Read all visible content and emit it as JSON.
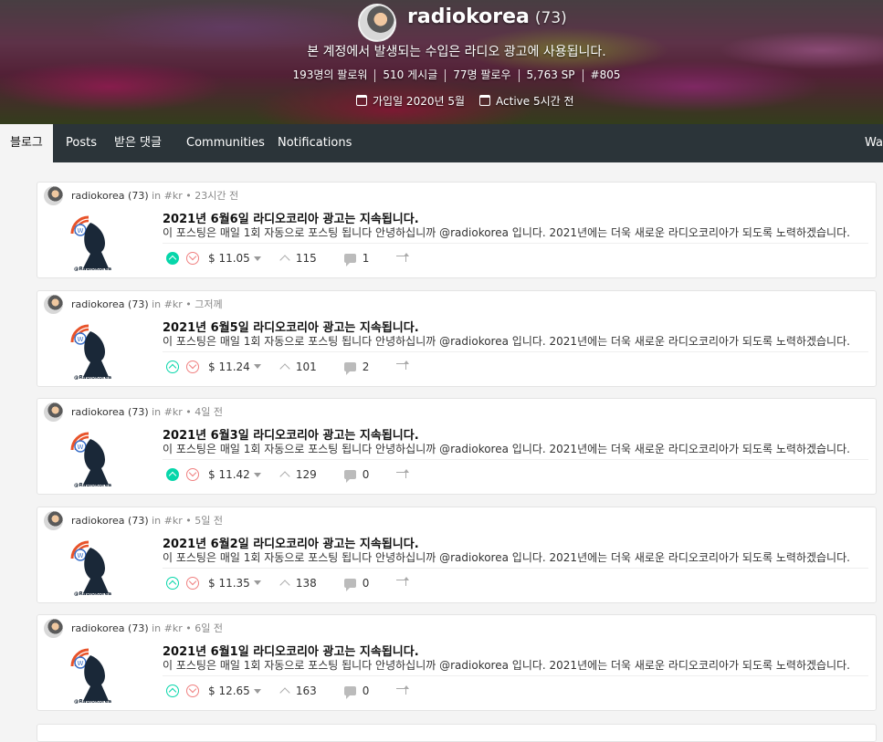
{
  "profile": {
    "username": "radiokorea",
    "reputation": "(73)",
    "subtitle": "본 계정에서 발생되는 수입은 라디오 광고에 사용됩니다.",
    "stats": {
      "followers": "193명의 팔로워",
      "posts": "510 게시글",
      "following": "77명 팔로우",
      "sp": "5,763 SP",
      "rank": "#805"
    },
    "joined": "가입일 2020년 5월",
    "active": "Active 5시간 전"
  },
  "nav": {
    "tabs": [
      {
        "label": "블로그",
        "active": true
      },
      {
        "label": "Posts"
      },
      {
        "label": "받은 댓글"
      },
      {
        "label": "Communities"
      },
      {
        "label": "Notifications"
      }
    ],
    "right_label": "Wa"
  },
  "posts": [
    {
      "author": "radiokorea (73)",
      "in": "in",
      "tag": "#kr",
      "time": "23시간 전",
      "title": "2021년 6월6일 라디오코리아 광고는 지속됩니다.",
      "excerpt": "이 포스팅은 매일 1회 자동으로 포스팅 됩니다 안녕하십니까 @radiokorea 입니다. 2021년에는 더욱 새로운 라디오코리아가 되도록 노력하겠습니다.",
      "upvoted": true,
      "payout": "$ 11.05",
      "votes": "115",
      "comments": "1"
    },
    {
      "author": "radiokorea (73)",
      "in": "in",
      "tag": "#kr",
      "time": "그저께",
      "title": "2021년 6월5일 라디오코리아 광고는 지속됩니다.",
      "excerpt": "이 포스팅은 매일 1회 자동으로 포스팅 됩니다 안녕하십니까 @radiokorea 입니다. 2021년에는 더욱 새로운 라디오코리아가 되도록 노력하겠습니다.",
      "upvoted": false,
      "payout": "$ 11.24",
      "votes": "101",
      "comments": "2"
    },
    {
      "author": "radiokorea (73)",
      "in": "in",
      "tag": "#kr",
      "time": "4일 전",
      "title": "2021년 6월3일 라디오코리아 광고는 지속됩니다.",
      "excerpt": "이 포스팅은 매일 1회 자동으로 포스팅 됩니다 안녕하십니까 @radiokorea 입니다. 2021년에는 더욱 새로운 라디오코리아가 되도록 노력하겠습니다.",
      "upvoted": true,
      "payout": "$ 11.42",
      "votes": "129",
      "comments": "0"
    },
    {
      "author": "radiokorea (73)",
      "in": "in",
      "tag": "#kr",
      "time": "5일 전",
      "title": "2021년 6월2일 라디오코리아 광고는 지속됩니다.",
      "excerpt": "이 포스팅은 매일 1회 자동으로 포스팅 됩니다 안녕하십니까 @radiokorea 입니다. 2021년에는 더욱 새로운 라디오코리아가 되도록 노력하겠습니다.",
      "upvoted": false,
      "payout": "$ 11.35",
      "votes": "138",
      "comments": "0"
    },
    {
      "author": "radiokorea (73)",
      "in": "in",
      "tag": "#kr",
      "time": "6일 전",
      "title": "2021년 6월1일 라디오코리아 광고는 지속됩니다.",
      "excerpt": "이 포스팅은 매일 1회 자동으로 포스팅 됩니다 안녕하십니까 @radiokorea 입니다. 2021년에는 더욱 새로운 라디오코리아가 되도록 노력하겠습니다.",
      "upvoted": false,
      "payout": "$ 12.65",
      "votes": "163",
      "comments": "0"
    }
  ],
  "thumb_caption": "@RadioKorea",
  "colors": {
    "navbar": "#2b3439",
    "upvote": "#07d6aa",
    "downvote": "#f08080",
    "logo_orange": "#e8532a",
    "logo_navy": "#1a2838"
  }
}
